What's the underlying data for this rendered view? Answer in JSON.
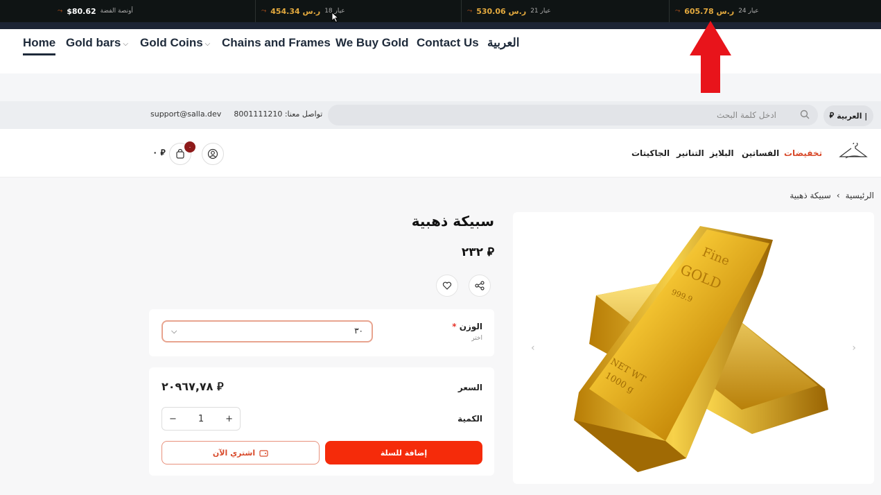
{
  "ticker": [
    {
      "label": "أونصة الفضة",
      "value": "$80.62",
      "white": true
    },
    {
      "label": "عيار 18",
      "value": "454.34 ر.س",
      "white": false
    },
    {
      "label": "عيار 21",
      "value": "530.06 ر.س",
      "white": false
    },
    {
      "label": "عيار 24",
      "value": "605.78 ر.س",
      "white": false
    }
  ],
  "topnav": {
    "home": "Home",
    "gold_bars": "Gold bars",
    "gold_coins": "Gold Coins",
    "chains": "Chains and Frames",
    "we_buy": "We Buy Gold",
    "contact": "Contact Us",
    "arabic": "العربية"
  },
  "storebar": {
    "email": "support@salla.dev",
    "phone": "8001111210",
    "phone_label": "تواصل معنا:",
    "search_placeholder": "ادخل كلمة البحث",
    "lang": "العربية |",
    "currency": "⃁"
  },
  "categories": [
    "تخفيضات",
    "الفساتين",
    "البلايز",
    "التنانير",
    "الجاكيتات"
  ],
  "cart": {
    "badge": "٠",
    "total": "٠ ⃁"
  },
  "breadcrumb": {
    "home": "الرئيسية",
    "sep": "›",
    "current": "سبيكة ذهبية"
  },
  "product": {
    "title": "سبيكة ذهبية",
    "price": "٢٣٢ ⃁",
    "weight_label": "الوزن",
    "weight_required": "*",
    "weight_hint": "اختر",
    "weight_value": "٣٠",
    "price_label": "السعر",
    "total_price": "٢٠٩٦٧,٧٨ ⃁",
    "qty_label": "الكمية",
    "qty": "1",
    "add_to_cart": "إضافة للسلة",
    "buy_now": "اشتري الآن"
  },
  "bar_image": {
    "line1": "Fine",
    "line2": "GOLD",
    "line3": "999.9",
    "line4": "NET WT",
    "line5": "1000 g"
  },
  "colors": {
    "accent": "#f52b0a",
    "gold": "#e3a93e",
    "arrow": "#e8141b"
  }
}
